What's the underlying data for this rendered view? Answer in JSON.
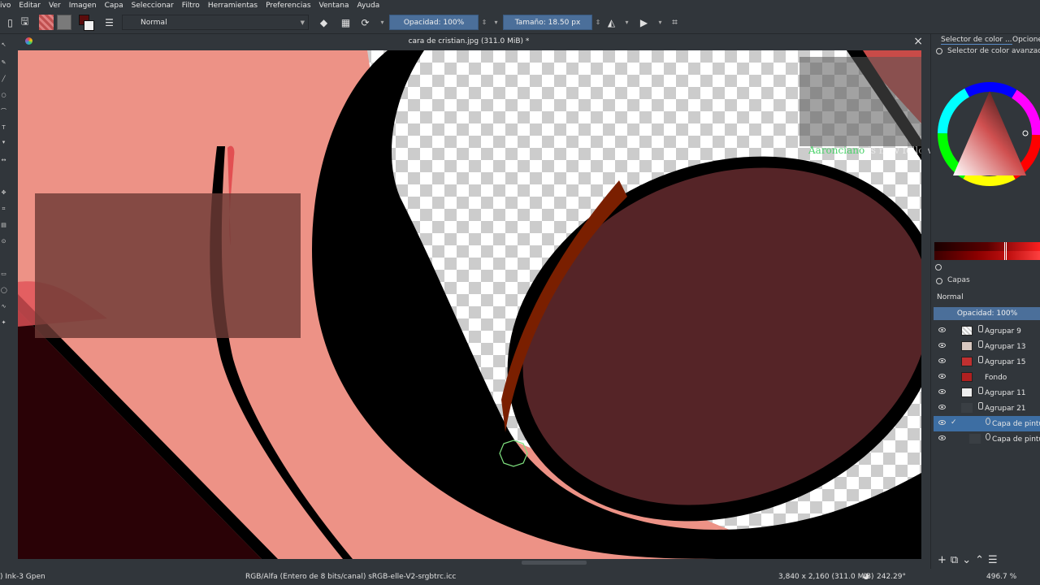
{
  "menu": [
    "ivo",
    "Editar",
    "Ver",
    "Imagen",
    "Capa",
    "Seleccionar",
    "Filtro",
    "Herramientas",
    "Preferencias",
    "Ventana",
    "Ayuda"
  ],
  "toolbar": {
    "blend_mode": "Normal",
    "opacity_label": "Opacidad: 100%",
    "size_label": "Tamaño: 18.50 px"
  },
  "document": {
    "title": "cara de cristian.jpg (311.0 MiB) *"
  },
  "notification": {
    "name": "Aaronciano",
    "text": " is now following!"
  },
  "dock": {
    "tabs": [
      "Selector de color ...",
      "Opciones"
    ],
    "color_selector_title": "Selector de color avanzado",
    "colors": {
      "fg": "#5a0c0c",
      "accent": "#4b6f9a"
    }
  },
  "layers": {
    "title": "Capas",
    "blend_mode": "Normal",
    "opacity_label": "Opacidad: 100%",
    "items": [
      {
        "name": "Agrupar 9",
        "type": "group"
      },
      {
        "name": "Agrupar 13",
        "type": "group"
      },
      {
        "name": "Agrupar 15",
        "type": "group"
      },
      {
        "name": "Fondo",
        "type": "paint"
      },
      {
        "name": "Agrupar 11",
        "type": "group"
      },
      {
        "name": "Agrupar 21",
        "type": "group"
      },
      {
        "name": "Capa de pintura",
        "type": "paint",
        "selected": true
      },
      {
        "name": "Capa de pintura",
        "type": "paint"
      }
    ]
  },
  "status": {
    "brush": ") Ink-3 Gpen",
    "color_model": "RGB/Alfa (Entero de 8 bits/canal)  sRGB-elle-V2-srgbtrc.icc",
    "image_size": "3,840 x 2,160 (311.0 MiB)",
    "rotation": "242.29°",
    "zoom": "496.7 %"
  }
}
